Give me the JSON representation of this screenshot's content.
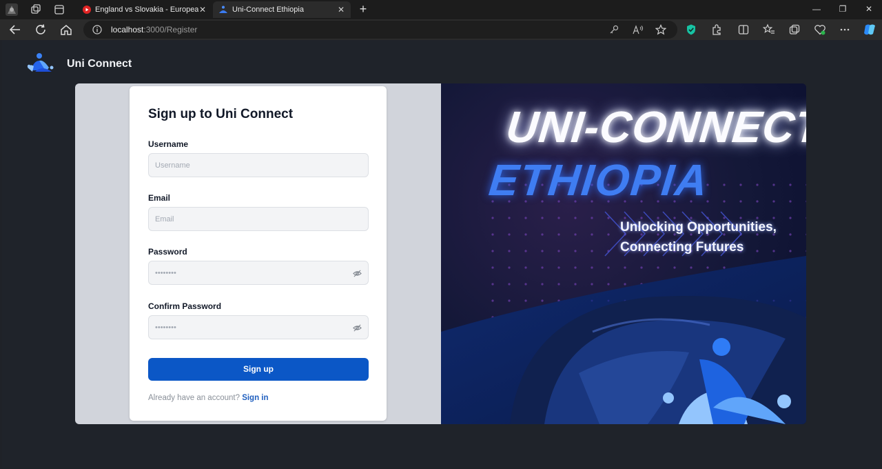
{
  "browser": {
    "tabs": [
      {
        "title": "England vs Slovakia - European C",
        "icon": "youtube-icon",
        "active": false
      },
      {
        "title": "Uni-Connect Ethiopia",
        "icon": "uni-connect-favicon",
        "active": true
      }
    ],
    "url_host": "localhost",
    "url_rest": ":3000/Register",
    "window_controls": [
      "—",
      "❐",
      "✕"
    ]
  },
  "header": {
    "brand_name": "Uni Connect"
  },
  "form": {
    "title": "Sign up to Uni Connect",
    "username_label": "Username",
    "username_placeholder": "Username",
    "email_label": "Email",
    "email_placeholder": "Email",
    "password_label": "Password",
    "password_placeholder": "••••••••",
    "confirm_label": "Confirm Password",
    "confirm_placeholder": "••••••••",
    "submit_label": "Sign up",
    "account_prompt": "Already have an account?",
    "signin_link": "Sign in"
  },
  "hero": {
    "title_line1": "UNI-CONNECT",
    "title_line2": "ETHIOPIA",
    "tagline_line1": "Unlocking Opportunities,",
    "tagline_line2": "Connecting Futures"
  },
  "colors": {
    "accent": "#0b57c6",
    "page_bg": "#1f232a",
    "hero_blue": "#3f7df2"
  }
}
